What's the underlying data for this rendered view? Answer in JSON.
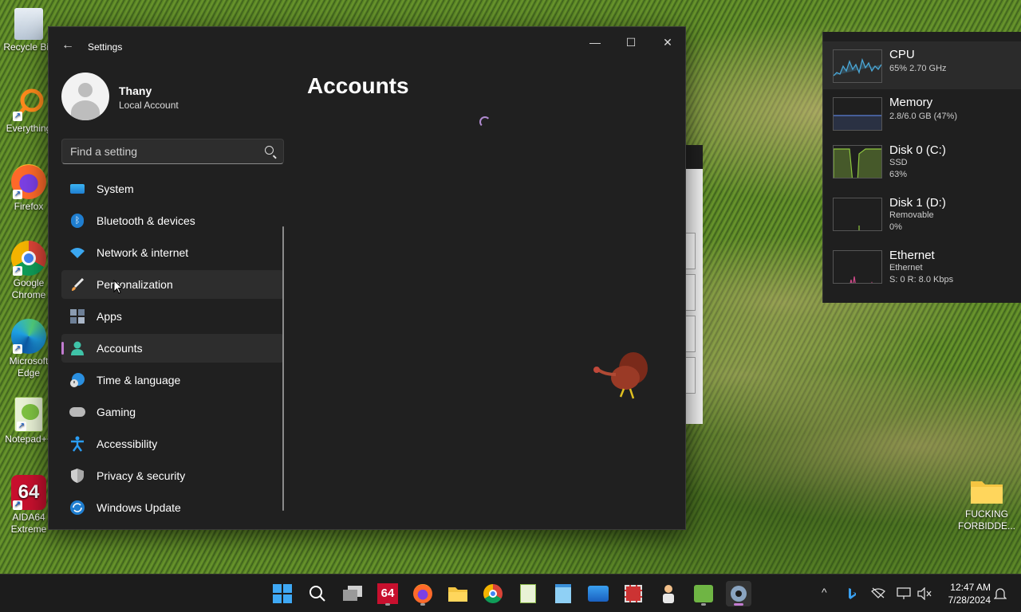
{
  "desktop": {
    "icons": [
      {
        "label": "Recycle Bin"
      },
      {
        "label": "Everything"
      },
      {
        "label": "Firefox"
      },
      {
        "label": "Google Chrome"
      },
      {
        "label": "Microsoft Edge"
      },
      {
        "label": "Notepad++"
      },
      {
        "label": "AIDA64 Extreme"
      }
    ],
    "folder_label": "FUCKING FORBIDDE..."
  },
  "settings": {
    "window_title": "Settings",
    "back_label": "←",
    "controls": {
      "minimize": "—",
      "maximize": "☐",
      "close": "✕"
    },
    "profile": {
      "name": "Thany",
      "account_type": "Local Account"
    },
    "search_placeholder": "Find a setting",
    "nav": [
      {
        "label": "System",
        "icon": "monitor-icon"
      },
      {
        "label": "Bluetooth & devices",
        "icon": "bluetooth-icon"
      },
      {
        "label": "Network & internet",
        "icon": "wifi-icon"
      },
      {
        "label": "Personalization",
        "icon": "brush-icon"
      },
      {
        "label": "Apps",
        "icon": "apps-icon"
      },
      {
        "label": "Accounts",
        "icon": "person-icon"
      },
      {
        "label": "Time & language",
        "icon": "globe-clock-icon"
      },
      {
        "label": "Gaming",
        "icon": "gamepad-icon"
      },
      {
        "label": "Accessibility",
        "icon": "accessibility-icon"
      },
      {
        "label": "Privacy & security",
        "icon": "shield-icon"
      },
      {
        "label": "Windows Update",
        "icon": "update-icon"
      }
    ],
    "selected": "Accounts",
    "hovered": "Personalization",
    "page_title": "Accounts"
  },
  "performance": [
    {
      "name": "CPU",
      "line1": "65% 2.70 GHz",
      "line2": "",
      "color": "#4aa8d8"
    },
    {
      "name": "Memory",
      "line1": "2.8/6.0 GB (47%)",
      "line2": "",
      "color": "#5b7fd6"
    },
    {
      "name": "Disk 0 (C:)",
      "line1": "SSD",
      "line2": "63%",
      "color": "#8ec63f"
    },
    {
      "name": "Disk 1 (D:)",
      "line1": "Removable",
      "line2": "0%",
      "color": "#8ec63f"
    },
    {
      "name": "Ethernet",
      "line1": "Ethernet",
      "line2": "S: 0 R: 8.0 Kbps",
      "color": "#d04a8a"
    }
  ],
  "taskbar": {
    "apps": [
      "start-icon",
      "search-icon",
      "task-view-icon",
      "aida64-icon",
      "firefox-icon",
      "file-explorer-icon",
      "chrome-icon",
      "notepadpp-icon",
      "notepad-icon",
      "photos-icon",
      "snipping-tool-icon",
      "app-person-icon",
      "steam-icon",
      "settings-icon"
    ],
    "aida_label": "64",
    "tray": {
      "chevron": "^"
    },
    "clock": {
      "time": "12:47 AM",
      "date": "7/28/2024"
    }
  }
}
